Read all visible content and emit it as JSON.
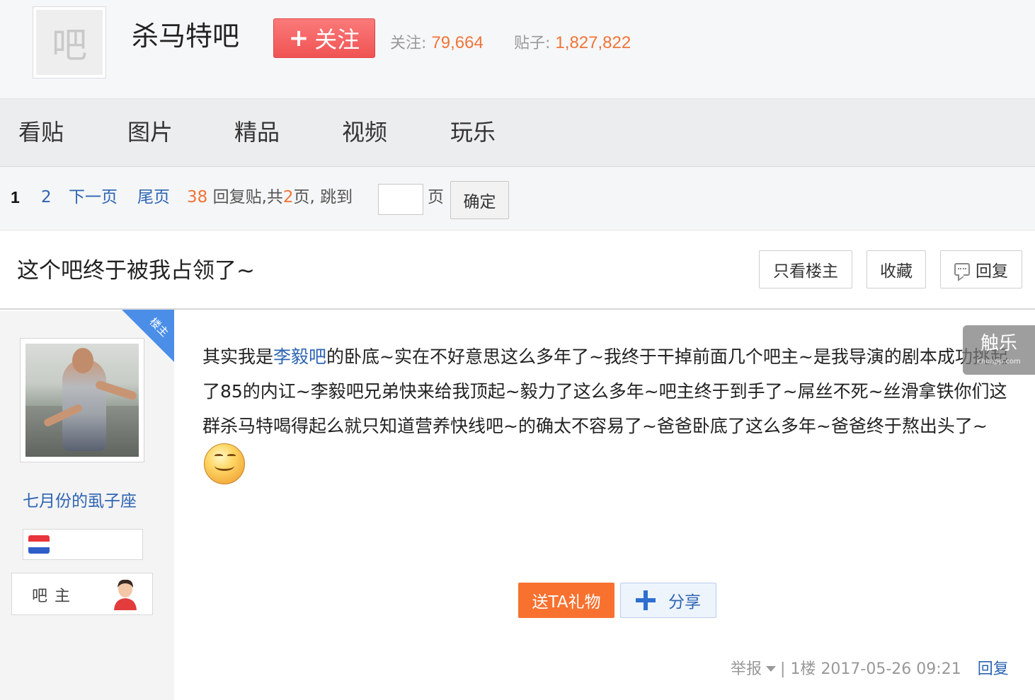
{
  "header": {
    "forum_avatar_char": "吧",
    "forum_name": "杀马特吧",
    "follow_plus": "+",
    "follow_label": "关注",
    "follow_count_label": "关注:",
    "follow_count": "79,664",
    "posts_count_label": "贴子:",
    "posts_count": "1,827,822"
  },
  "nav": {
    "tabs": [
      {
        "label": "看贴"
      },
      {
        "label": "图片"
      },
      {
        "label": "精品"
      },
      {
        "label": "视频"
      },
      {
        "label": "玩乐"
      }
    ]
  },
  "pager": {
    "current_page": "1",
    "page_2": "2",
    "next_page": "下一页",
    "last_page": "尾页",
    "reply_count": "38",
    "reply_text": "回复贴,共",
    "total_pages": "2",
    "pages_suffix": "页,",
    "jump_to": "跳到",
    "page_unit": "页",
    "input_value": "",
    "confirm_label": "确定"
  },
  "thread": {
    "title": "这个吧终于被我占领了~",
    "only_owner_label": "只看楼主",
    "favorite_label": "收藏",
    "reply_label": "回复"
  },
  "author": {
    "badge": "楼主",
    "name": "七月份的虱子座",
    "role": "吧主",
    "flag_colors": [
      "#e8353b",
      "#ffffff",
      "#2f5ec8"
    ]
  },
  "post": {
    "text_before_link": "其实我是",
    "link_text": "李毅吧",
    "text_after_link": "的卧底~实在不好意思这么多年了~我终于干掉前面几个吧主~是我导演的剧本成功挑起了85的内讧~李毅吧兄弟快来给我顶起~毅力了这么多年~吧主终于到手了~屌丝不死~丝滑拿铁你们这群杀马特喝得起么就只知道营养快线吧~的确太不容易了~爸爸卧底了这么多年~爸爸终于熬出头了~",
    "emoji": "smiley-icon",
    "gift_label": "送TA礼物",
    "share_label": "分享"
  },
  "footer": {
    "report": "举报",
    "separator": "|",
    "floor": "1楼",
    "datetime": "2017-05-26 09:21",
    "reply": "回复"
  },
  "watermark": {
    "big": "触乐",
    "small": "chuapp.com"
  },
  "colors": {
    "accent_red": "#f05353",
    "link_blue": "#2d64b3",
    "orange": "#f07538",
    "badge_blue": "#4b8ee8",
    "gift_orange": "#f8712f"
  }
}
